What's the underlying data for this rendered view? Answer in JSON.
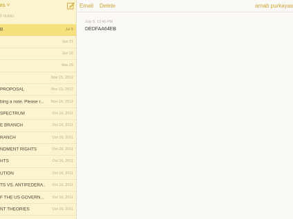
{
  "sidebar": {
    "folder_title": "tes ˅",
    "search_placeholder": "ll notes",
    "notes": [
      {
        "title": "B",
        "date": "Jul 5",
        "selected": true
      },
      {
        "title": "",
        "date": "Jun 27"
      },
      {
        "title": "",
        "date": "Jun 16"
      },
      {
        "title": "",
        "date": "Mar 29"
      },
      {
        "title": "",
        "date": "Nov 15, 2012"
      },
      {
        "title": "PROPOSAL",
        "date": "Nov 13, 2012"
      },
      {
        "title": "bing a note. Please r...",
        "date": "Nov 10, 2012"
      },
      {
        "title": "SPECTRUM",
        "date": "Oct 16, 2011"
      },
      {
        "title": "E BRANCH",
        "date": "Oct 16, 2011"
      },
      {
        "title": "RANCH",
        "date": "Oct 16, 2011"
      },
      {
        "title": "NDMENT RIGHTS",
        "date": "Oct 16, 2011"
      },
      {
        "title": "HTS",
        "date": "Oct 16, 2011"
      },
      {
        "title": "UTION",
        "date": "Oct 16, 2011"
      },
      {
        "title": "TS VS. ANTIFEDERA...",
        "date": "Oct 16, 2011"
      },
      {
        "title": "F THE US GOVERN...",
        "date": "Oct 16, 2011"
      },
      {
        "title": "NT THEORIES",
        "date": "Oct 16, 2011"
      },
      {
        "title": "",
        "date": ""
      }
    ]
  },
  "toolbar": {
    "email_label": "Email",
    "delete_label": "Delete",
    "account_label": "arnab purkayas"
  },
  "note": {
    "meta": "July 5, 12:40 PM",
    "body": "DEDFAA64EB"
  },
  "colors": {
    "accent": "#cda535",
    "sidebar_bg": "#fcf4cf",
    "selected_bg": "#f6e17e"
  },
  "icons": {
    "compose": "compose-icon"
  }
}
